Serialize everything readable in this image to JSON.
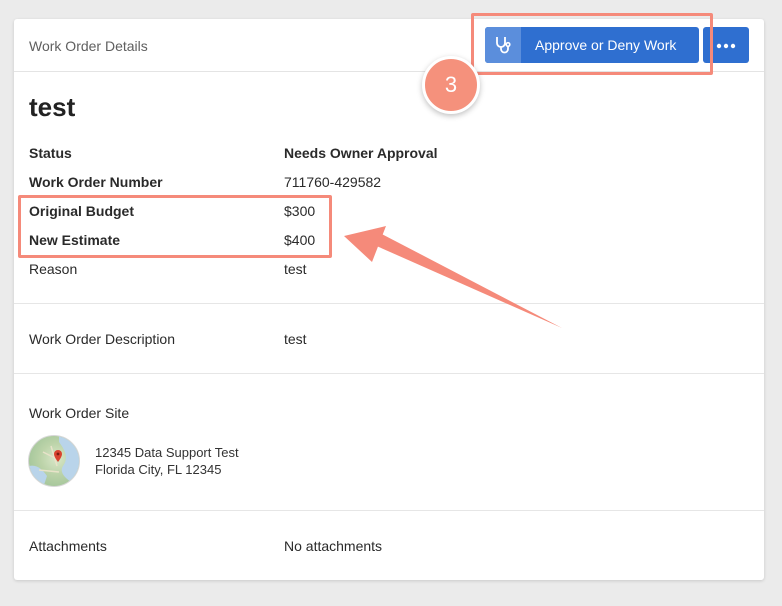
{
  "card": {
    "header_title": "Work Order Details",
    "approve_button_label": "Approve or Deny Work",
    "more_icon": "ellipsis-icon",
    "approve_icon": "stethoscope-icon"
  },
  "work_order": {
    "title": "test",
    "fields": [
      {
        "label": "Status",
        "value": "Needs Owner Approval"
      },
      {
        "label": "Work Order Number",
        "value": "711760-429582"
      },
      {
        "label": "Original Budget",
        "value": "$300"
      },
      {
        "label": "New Estimate",
        "value": "$400"
      },
      {
        "label": "Reason",
        "value": "test"
      }
    ],
    "description": {
      "label": "Work Order Description",
      "value": "test"
    },
    "site": {
      "label": "Work Order Site",
      "address_line1": "12345 Data Support Test",
      "address_line2": "Florida City, FL 12345"
    },
    "attachments": {
      "label": "Attachments",
      "value": "No attachments"
    }
  },
  "annotation": {
    "step_number": "3",
    "color": "#f58a7a"
  },
  "colors": {
    "primary_button": "#2f6fd0",
    "background": "#ebebeb"
  }
}
